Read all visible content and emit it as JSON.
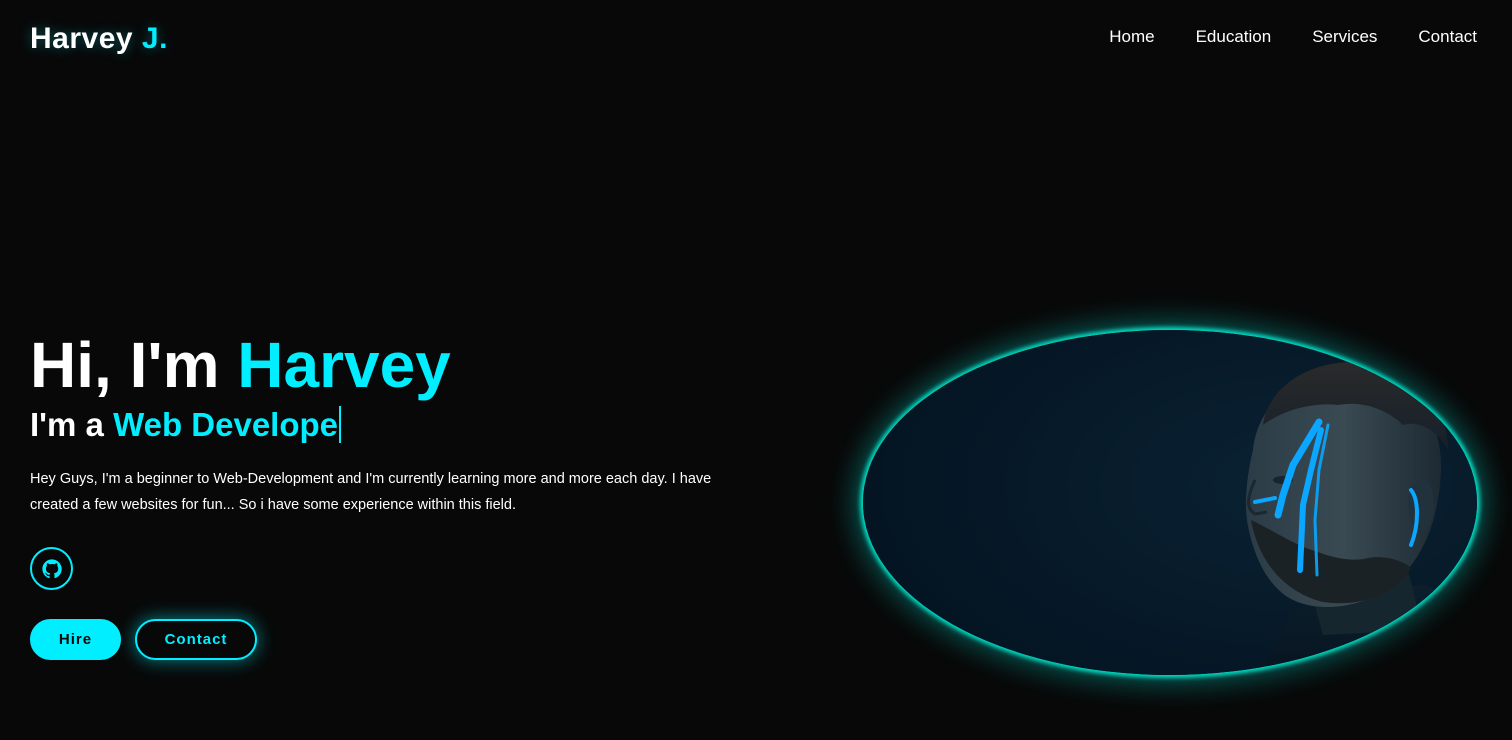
{
  "header": {
    "logo_main": "Harvey ",
    "logo_accent": "J.",
    "nav": [
      {
        "label": "Home"
      },
      {
        "label": "Education"
      },
      {
        "label": "Services"
      },
      {
        "label": "Contact"
      }
    ]
  },
  "hero": {
    "title_prefix": "Hi, I'm ",
    "title_name": "Harvey",
    "subtitle_prefix": "I'm a ",
    "subtitle_role": "Web Develope",
    "description": "Hey Guys, I'm a beginner to Web-Development and I'm currently learning more and more each day. I have created a few websites for fun... So i have some experience within this field.",
    "social_icon": "github-icon",
    "buttons": {
      "hire_label": "Hire",
      "contact_label": "Contact"
    }
  },
  "colors": {
    "accent": "#00eeff",
    "background": "#080808",
    "text": "#ffffff",
    "image_bg": "#06192a"
  },
  "image": {
    "subject": "portrait-photo"
  }
}
